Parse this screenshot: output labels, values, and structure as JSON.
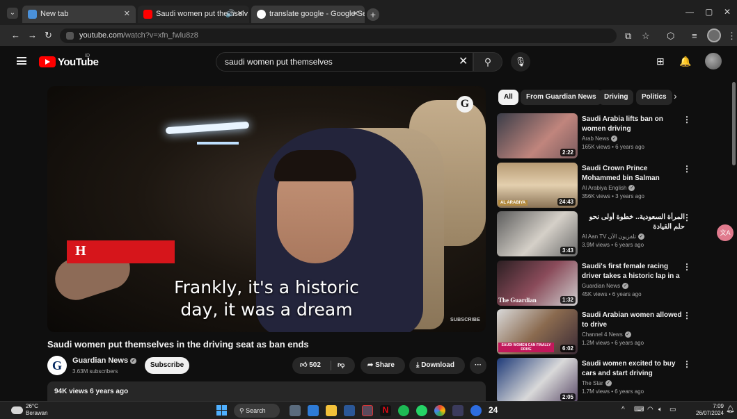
{
  "browser": {
    "tabs": [
      {
        "title": "New tab"
      },
      {
        "title": "Saudi women put themselv"
      },
      {
        "title": "translate google - Google Sear"
      }
    ],
    "url_host": "youtube.com",
    "url_path": "/watch?v=xfn_fwlu8z8",
    "colors": {
      "tab_active": "#262626",
      "tab_inactive": "#3a3a3a"
    }
  },
  "youtube": {
    "logo_text": "YouTube",
    "region_code": "ID",
    "search_value": "saudi women put themselves",
    "brand_red": "#ff0000"
  },
  "video": {
    "caption_line1": "Frankly, it's a historic",
    "caption_line2": "day, it was a dream",
    "overlay_letter": "H",
    "logo_letter": "G",
    "watermark": "SUBSCRIBE",
    "title": "Saudi women put themselves in the driving seat as ban ends",
    "channel": "Guardian News",
    "subscribers": "3.63M subscribers",
    "subscribe_label": "Subscribe",
    "likes": "502",
    "share_label": "Share",
    "download_label": "Download",
    "views_and_date": "94K views  6 years ago"
  },
  "chips": [
    {
      "label": "All",
      "active": true
    },
    {
      "label": "From Guardian News",
      "active": false
    },
    {
      "label": "Driving",
      "active": false
    },
    {
      "label": "Politics",
      "active": false
    }
  ],
  "suggestions": [
    {
      "title": "Saudi Arabia lifts ban on women driving",
      "channel": "Arab News",
      "meta": "165K views • 6 years ago",
      "duration": "2:22",
      "thumb_text": "",
      "rtl": false
    },
    {
      "title": "Saudi Crown Prince Mohammed bin Salman interview on Visio...",
      "channel": "Al Arabiya English",
      "meta": "356K views • 3 years ago",
      "duration": "24:43",
      "thumb_text": "AL ARABIYA",
      "rtl": false
    },
    {
      "title": "المرأة السعودية.. خطوة أولى نحو حلم القيادة",
      "channel": "Al Aan TV تلفزيون الآن",
      "meta": "3.9M views • 6 years ago",
      "duration": "3:43",
      "thumb_text": "",
      "rtl": true
    },
    {
      "title": "Saudi's first female racing driver takes a historic lap in a circuit ...",
      "channel": "Guardian News",
      "meta": "45K views • 6 years ago",
      "duration": "1:32",
      "thumb_text": "The Guardian",
      "rtl": false
    },
    {
      "title": "Saudi Arabian women allowed to drive",
      "channel": "Channel 4 News",
      "meta": "1.2M views • 6 years ago",
      "duration": "6:02",
      "thumb_text": "SAUDI WOMEN CAN FINALLY DRIVE",
      "rtl": false
    },
    {
      "title": "Saudi women excited to buy cars and start driving",
      "channel": "The Star",
      "meta": "1.7M views • 6 years ago",
      "duration": "2:05",
      "thumb_text": "",
      "rtl": false
    }
  ],
  "taskbar": {
    "temperature": "26°C",
    "weather": "Berawan",
    "search_label": "Search",
    "time": "7:09",
    "date": "26/07/2024"
  }
}
